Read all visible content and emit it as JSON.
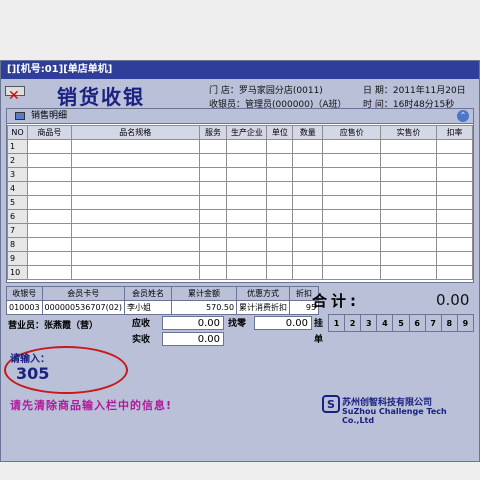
{
  "window": {
    "title": "[][机号:01][单店单机]"
  },
  "header": {
    "app_title": "销货收银",
    "store_label": "门 店：",
    "store_value": "罗马家园分店(0011)",
    "date_label": "日 期：",
    "date_value": "2011年11月20日",
    "cashier_label": "收银员：",
    "cashier_value": "管理员(000000)（A班）",
    "time_label": "时 间：",
    "time_value": "16时48分15秒"
  },
  "panel": {
    "title": "销售明细"
  },
  "grid": {
    "columns": [
      "NO",
      "商品号",
      "品名规格",
      "服务",
      "生产企业",
      "单位",
      "数量",
      "应售价",
      "实售价",
      "扣率"
    ],
    "rows": [
      "1",
      "2",
      "3",
      "4",
      "5",
      "6",
      "7",
      "8",
      "9",
      "10"
    ]
  },
  "member": {
    "headers": [
      "收银号",
      "会员卡号",
      "会员姓名",
      "累计金额",
      "优惠方式",
      "折扣"
    ],
    "values": [
      "010003",
      "000000536707(02)",
      "李小姐",
      "570.50",
      "累计消费折扣",
      "95"
    ]
  },
  "totals": {
    "total_label": "合计:",
    "total_value": "0.00",
    "clerk_label": "营业员：",
    "clerk_value": "张燕霞（营）",
    "receivable_label": "应收",
    "receivable_value": "0.00",
    "received_label": "实收",
    "received_value": "0.00",
    "change_label": "找零",
    "change_value": "0.00",
    "hang_label": "挂",
    "hang_label2": "单",
    "slots": [
      "1",
      "2",
      "3",
      "4",
      "5",
      "6",
      "7",
      "8",
      "9"
    ]
  },
  "input": {
    "label": "请输入：",
    "value": "305"
  },
  "message": "请先清除商品输入栏中的信息!",
  "company": {
    "name_cn": "苏州创智科技有限公司",
    "name_en": "SuZhou Challenge Tech Co.,Ltd",
    "logo_glyph": "S"
  },
  "colors": {
    "titlebar": "#2f3f99",
    "panel": "#b9c0d8",
    "message": "#b01a9a",
    "highlight": "#c81818"
  }
}
